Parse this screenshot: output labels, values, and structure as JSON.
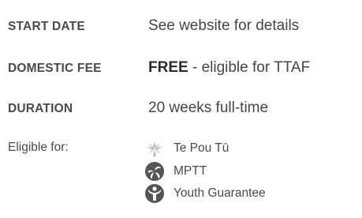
{
  "details": {
    "start_date": {
      "label": "START DATE",
      "value": "See website for details"
    },
    "domestic_fee": {
      "label": "DOMESTIC FEE",
      "value_strong": "FREE",
      "value_rest": " - eligible for TTAF"
    },
    "duration": {
      "label": "DURATION",
      "value": "20 weeks full-time"
    }
  },
  "eligibility": {
    "label": "Eligible for:",
    "items": [
      {
        "label": "Te Pou Tū",
        "icon": "te-pou-tu-icon",
        "color": "#b8b8b8"
      },
      {
        "label": "MPTT",
        "icon": "mptt-icon",
        "color": "#555555"
      },
      {
        "label": "Youth Guarantee",
        "icon": "youth-guarantee-icon",
        "color": "#555555"
      }
    ]
  }
}
